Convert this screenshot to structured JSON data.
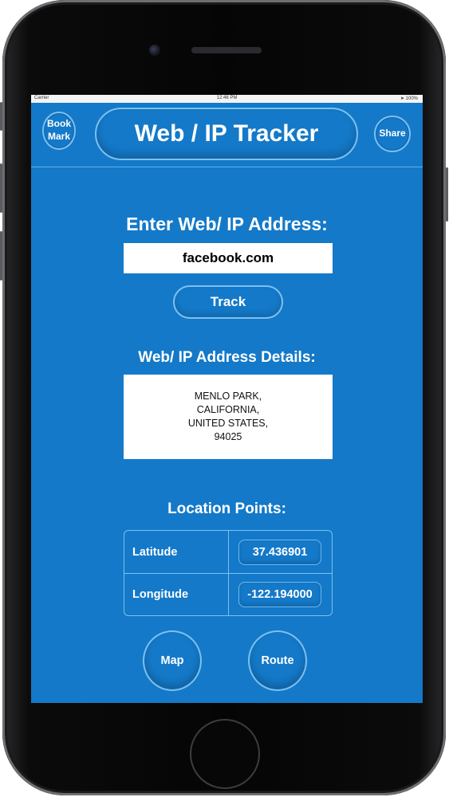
{
  "status_bar": {
    "carrier": "Carrier",
    "time": "12:46 PM",
    "battery": "100%"
  },
  "header": {
    "bookmark_line1": "Book",
    "bookmark_line2": "Mark",
    "title": "Web / IP Tracker",
    "share_label": "Share"
  },
  "search": {
    "label": "Enter Web/ IP Address:",
    "value": "facebook.com",
    "track_label": "Track"
  },
  "details": {
    "label": "Web/ IP Address Details:",
    "lines": [
      "MENLO PARK,",
      "CALIFORNIA,",
      "UNITED STATES,",
      "94025"
    ]
  },
  "location": {
    "label": "Location Points:",
    "latitude_label": "Latitude",
    "latitude_value": "37.436901",
    "longitude_label": "Longitude",
    "longitude_value": "-122.194000"
  },
  "actions": {
    "map_label": "Map",
    "route_label": "Route"
  },
  "colors": {
    "app_background": "#1479c8",
    "button_outline": "#7cc0f0",
    "phone_body": "#0b0b0c"
  }
}
